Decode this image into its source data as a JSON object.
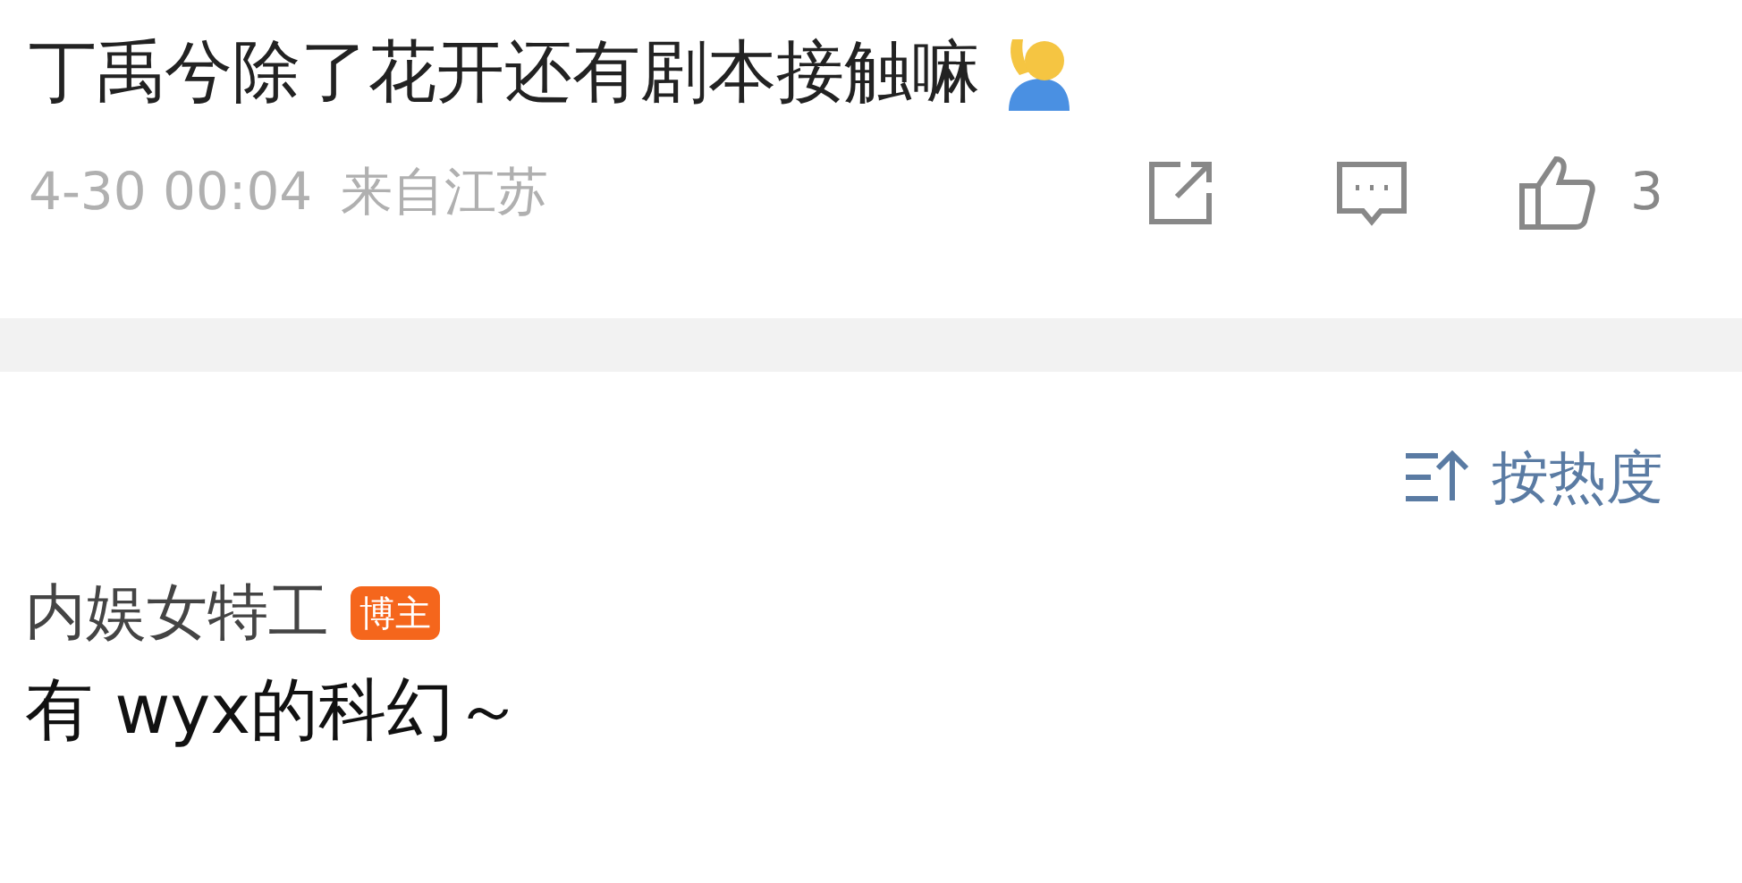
{
  "post": {
    "text": "丁禹兮除了花开还有剧本接触嘛",
    "date": "4-30 00:04",
    "location": "来自江苏",
    "like_count": "3"
  },
  "sort": {
    "label": "按热度"
  },
  "comments": [
    {
      "author": "内娱女特工",
      "badge": "博主",
      "text": "有 wyx的科幻～"
    }
  ]
}
